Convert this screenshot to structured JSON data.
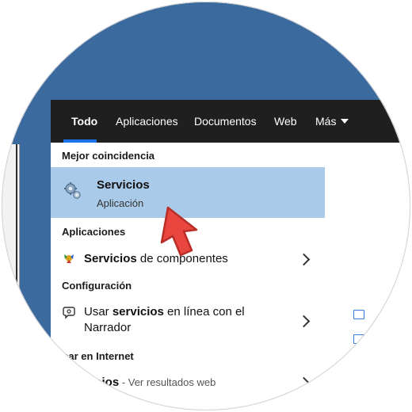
{
  "tabs": [
    {
      "label": "Todo",
      "active": true
    },
    {
      "label": "Aplicaciones"
    },
    {
      "label": "Documentos"
    },
    {
      "label": "Web"
    },
    {
      "label": "Más"
    }
  ],
  "sections": {
    "best_match": "Mejor coincidencia",
    "apps": "Aplicaciones",
    "settings": "Configuración",
    "web": "uscar en Internet"
  },
  "best_match": {
    "title": "Servicios",
    "subtitle": "Aplicación",
    "icon": "services-gear-icon"
  },
  "apps": [
    {
      "label_bold": "Servicios",
      "label_rest": " de componentes",
      "icon": "component-services-icon"
    }
  ],
  "settings": [
    {
      "line1_pre": "Usar ",
      "line1_bold": "servicios",
      "line1_post": " en línea con el",
      "line2": "Narrador",
      "icon": "narrator-icon"
    }
  ],
  "web": [
    {
      "label_bold": "icios",
      "label_rest": " - Ver resultados web"
    }
  ],
  "colors": {
    "tabbar": "#1f1f1f",
    "accent": "#1a73e8",
    "selection": "#a9cbe9",
    "wallpaper": "#3a6a9e",
    "pointer": "#e8463f"
  }
}
